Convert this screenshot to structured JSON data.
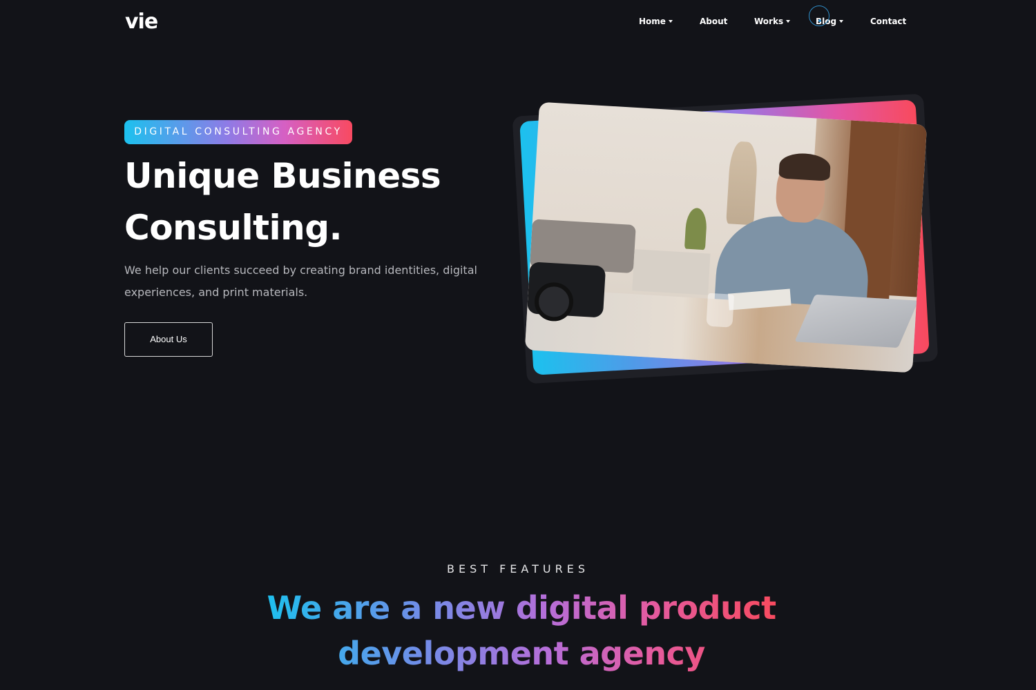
{
  "header": {
    "logo": "vie",
    "nav": [
      {
        "label": "Home",
        "dropdown": true
      },
      {
        "label": "About",
        "dropdown": false
      },
      {
        "label": "Works",
        "dropdown": true
      },
      {
        "label": "Blog",
        "dropdown": true
      },
      {
        "label": "Contact",
        "dropdown": false
      }
    ]
  },
  "hero": {
    "badge": "DIGITAL CONSULTING AGENCY",
    "title_line1": "Unique Business",
    "title_line2": "Consulting.",
    "description": "We help our clients succeed by creating brand identities, digital experiences, and print materials.",
    "button_label": "About Us"
  },
  "features": {
    "label": "BEST FEATURES",
    "title_line1": "We are a new digital product",
    "title_line2": "development agency"
  },
  "colors": {
    "background": "#121318",
    "gradient_start": "#1cc1ee",
    "gradient_mid": "#b66ed9",
    "gradient_end": "#f84a5d"
  }
}
